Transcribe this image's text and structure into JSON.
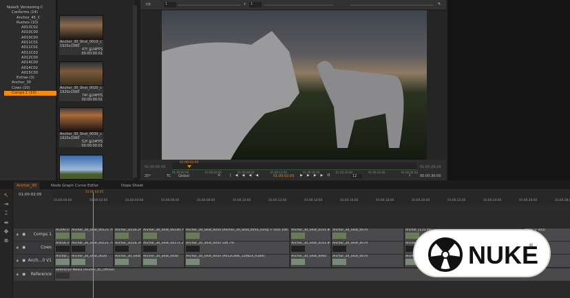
{
  "bin": {
    "tree": [
      {
        "label": "Nuke9_Versioning C",
        "indent": 0
      },
      {
        "label": "Conforms (14)",
        "indent": 1
      },
      {
        "label": "Anchor_45_C",
        "indent": 2
      },
      {
        "label": "Rushes (10)",
        "indent": 2
      },
      {
        "label": "A013C02",
        "indent": 3
      },
      {
        "label": "A010C00",
        "indent": 3
      },
      {
        "label": "A010C00",
        "indent": 3
      },
      {
        "label": "A011C01",
        "indent": 3
      },
      {
        "label": "A011C01",
        "indent": 3
      },
      {
        "label": "A011C02",
        "indent": 3
      },
      {
        "label": "A012C00",
        "indent": 3
      },
      {
        "label": "A014C00",
        "indent": 3
      },
      {
        "label": "A014C02",
        "indent": 3
      },
      {
        "label": "A015C00",
        "indent": 3
      },
      {
        "label": "Extras (3)",
        "indent": 2
      },
      {
        "label": "Anchor_30",
        "indent": 1
      },
      {
        "label": "Cows (10)",
        "indent": 1
      },
      {
        "label": "Comps 1 (10)",
        "indent": 1,
        "selected": true
      }
    ],
    "thumbs": [
      {
        "name": "Anchor_30_Shot_0010_c",
        "res": "1920x1080",
        "info": "47f @24FPS",
        "tc": "00:00:00:01"
      },
      {
        "name": "Anchor_30_Shot_0020_c",
        "res": "1920x1080",
        "info": "74f @24FPS",
        "tc": "00:00:00:01"
      },
      {
        "name": "Anchor_30_Shot_0030_c",
        "res": "1920x1080",
        "info": "52f @24FPS",
        "tc": "00:00:00:01"
      }
    ]
  },
  "viewer": {
    "frame_label": "f/8",
    "gain": "1",
    "gamma_label": "Y",
    "gamma": "1",
    "in_tc": "01:00:00:00",
    "out_tc": "01:00:29:24",
    "playhead_tc": "01:00:02:05",
    "current_tc": "01:00:02:05",
    "duration": "00:00:30:00",
    "fps": "25*",
    "tc_mode": "TC",
    "scope": "Global",
    "step": "12",
    "ruler": [
      "01:00:00:00",
      "01:00:04:00",
      "01:00:08:00",
      "01:00:12:00",
      "01:00:16:00",
      "01:00:20:00",
      "01:00:24:00",
      "01:00:29:24"
    ]
  },
  "tabs": [
    {
      "label": "Anchor_30"
    },
    {
      "label": "Node Graph"
    },
    {
      "label": "Curve Editor"
    },
    {
      "label": "Dope Sheet"
    }
  ],
  "timeline": {
    "current_tc": "01:00:02:05",
    "playhead_tc": "01:00:02:05",
    "ruler": [
      "01:00:00:00",
      "01:00:02:00",
      "01:00:04:00",
      "01:00:06:00",
      "01:00:08:00",
      "01:00:10:00",
      "01:00:12:00",
      "01:00:14:00",
      "01:00:16:00",
      "01:00:18:00",
      "01:00:20:00",
      "01:00:22:00",
      "01:00:24:00",
      "01:00:26:00",
      "01:00:28:00"
    ],
    "tracks": [
      {
        "name": "Comps 1",
        "clips": [
          "Ar209.1%",
          "Anchor_30_Shot_00121.7%",
          "Anchor_3I134.2%",
          "Anchor_30_Shot_00140.7%",
          "Anchor_30_Shot_0050 (Anchor_30_Shot_0050_comp > v03)  100.7%",
          "Anchor_30_Shot_0101.8%",
          "Anchor_30_Shot_0070",
          "Anchor_[133.3%",
          "comp > v03)"
        ]
      },
      {
        "name": "Cows",
        "clips": [
          "An654.5%",
          "Anchor_30_Shot_00121.7%",
          "Anchor_3I226.3%",
          "Anchor_30_Shot_00171.2%",
          "Anchor_30_Shot_0050  100.7%",
          "Anchor_30_Shot_0101.8%",
          "Anchor_30_Shot_0070",
          "Anchor",
          "> v01)"
        ]
      },
      {
        "name": "Anch...0 V1",
        "clips": [
          "Anchor_3I",
          "Anchor_30_Shot_0020",
          "Anchor_30_Shot_(",
          "Anchor_30_Shot_0040",
          "Anchor_30_Shot_0050 (A012C006_120824_R3BR)",
          "Anchor_30_Shot_0060",
          "Anchor_30_Shot_0070",
          "Anch",
          ""
        ]
      },
      {
        "name": "Reference",
        "clips": [
          "Reference Media (Anchor_45_Offline)"
        ]
      }
    ]
  },
  "logo": {
    "text": "NUKE",
    "mark": "®"
  }
}
